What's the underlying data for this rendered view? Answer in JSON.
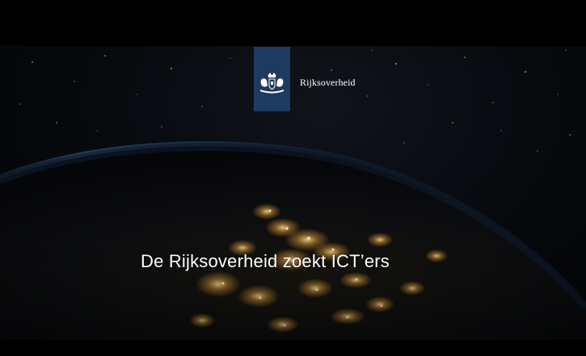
{
  "brand": {
    "wordmark": "Rijksoverheid",
    "emblem_icon": "coat-of-arms-icon",
    "emblem_color": "#1f3a5f"
  },
  "video": {
    "caption": "De Rijksoverheid zoekt ICT’ers"
  }
}
